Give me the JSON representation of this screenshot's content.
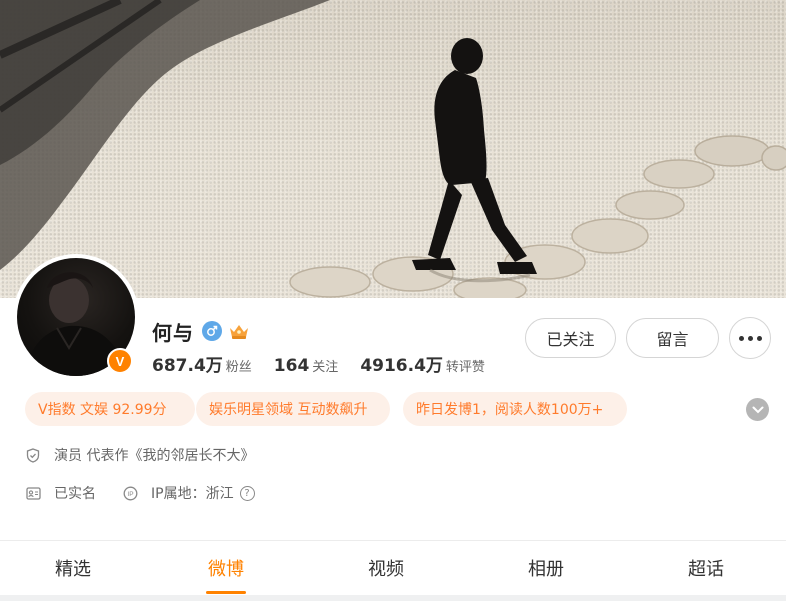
{
  "profile": {
    "name": "何与",
    "gender_icon": "male-icon",
    "crown_icon": "crown-icon",
    "verified_badge": "V",
    "stats": {
      "followers": {
        "value": "687.4万",
        "label": "粉丝"
      },
      "following": {
        "value": "164",
        "label": "关注"
      },
      "interactions": {
        "value": "4916.4万",
        "label": "转评赞"
      }
    }
  },
  "actions": {
    "follow_label": "已关注",
    "message_label": "留言",
    "more_icon": "more-icon"
  },
  "tags": [
    {
      "label": "V指数 文娱 92.99分"
    },
    {
      "label": "娱乐明星领域 互动数飙升"
    },
    {
      "label": "昨日发博1，阅读人数100万+"
    }
  ],
  "info": {
    "bio": "演员 代表作《我的邻居长不大》",
    "realname": "已实名",
    "ip": "IP属地：浙江"
  },
  "tabs": [
    {
      "label": "精选",
      "active": false
    },
    {
      "label": "微博",
      "active": true
    },
    {
      "label": "视频",
      "active": false
    },
    {
      "label": "相册",
      "active": false
    },
    {
      "label": "超话",
      "active": false
    }
  ],
  "colors": {
    "accent": "#ff8200",
    "chip_bg": "#fdf0e8",
    "chip_text": "#ff7b2c",
    "gender_blue": "#5fa8e8"
  }
}
